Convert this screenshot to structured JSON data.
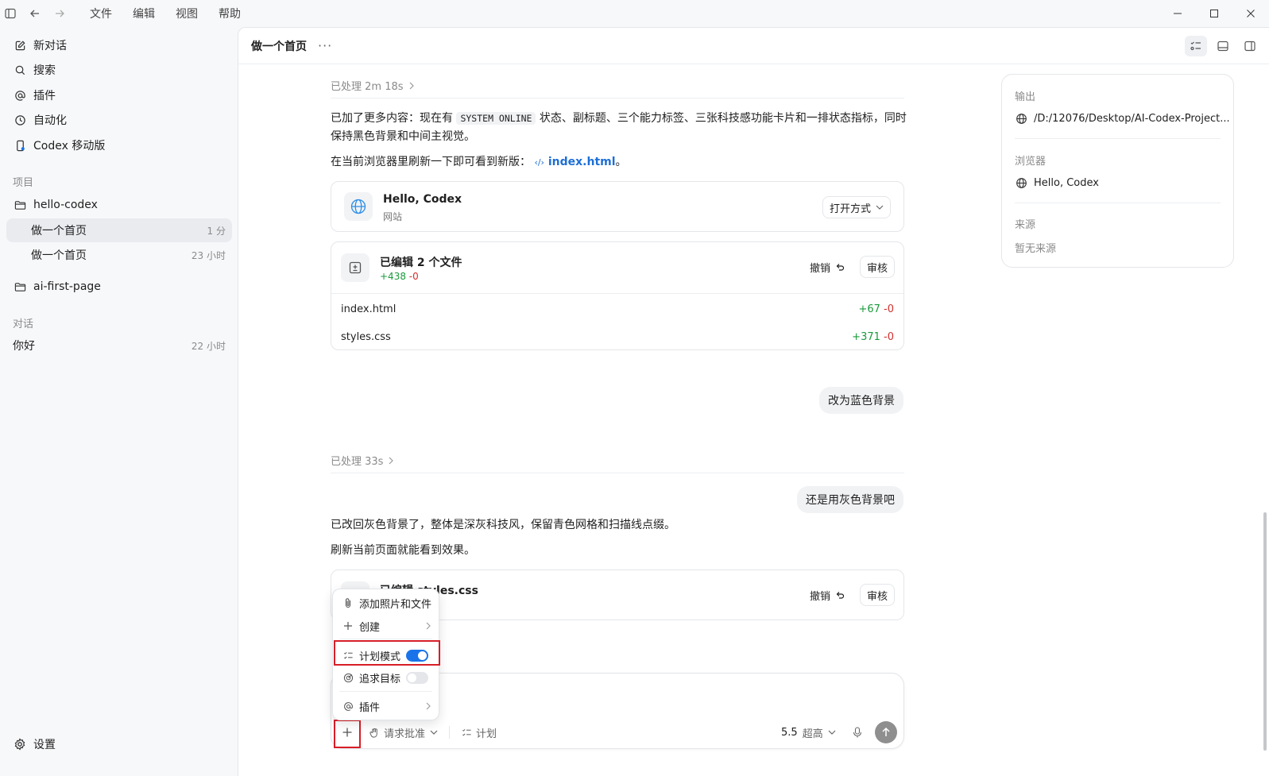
{
  "titlebar": {
    "menu": [
      "文件",
      "编辑",
      "视图",
      "帮助"
    ]
  },
  "sidebar": {
    "top_items": [
      {
        "label": "新对话",
        "icon": "edit-icon"
      },
      {
        "label": "搜索",
        "icon": "search-icon"
      },
      {
        "label": "插件",
        "icon": "at-icon"
      },
      {
        "label": "自动化",
        "icon": "clock-icon"
      },
      {
        "label": "Codex 移动版",
        "icon": "mobile-icon"
      }
    ],
    "projects_label": "项目",
    "projects": [
      {
        "name": "hello-codex",
        "icon": "folder-icon",
        "threads": [
          {
            "label": "做一个首页",
            "meta": "1 分",
            "active": true
          },
          {
            "label": "做一个首页",
            "meta": "23 小时",
            "active": false
          }
        ]
      },
      {
        "name": "ai-first-page",
        "icon": "folder-icon",
        "threads": []
      }
    ],
    "chats_label": "对话",
    "chats": [
      {
        "label": "你好",
        "meta": "22 小时"
      }
    ],
    "settings_label": "设置"
  },
  "main": {
    "title": "做一个首页",
    "more": "···",
    "processed_1": "已处理 2m 18s",
    "msg1_part1": "已加了更多内容：现在有",
    "msg1_code": "SYSTEM ONLINE",
    "msg1_part2": "状态、副标题、三个能力标签、三张科技感功能卡片和一排状态指标，同时",
    "msg1_line2": "保持黑色背景和中间主视觉。",
    "msg2_prefix": "在当前浏览器里刷新一下即可看到新版：",
    "msg2_link": "index.html",
    "msg2_suffix": "。",
    "site_card": {
      "title": "Hello, Codex",
      "subtitle": "网站",
      "open_with": "打开方式"
    },
    "edit_card": {
      "title": "已编辑 2 个文件",
      "added": "+438",
      "removed": "-0",
      "undo": "撤销",
      "review": "审核",
      "files": [
        {
          "name": "index.html",
          "added": "+67",
          "removed": "-0"
        },
        {
          "name": "styles.css",
          "added": "+371",
          "removed": "-0"
        }
      ]
    },
    "user_msg_1": "改为蓝色背景",
    "processed_2": "已处理 33s",
    "user_msg_2": "还是用灰色背景吧",
    "msg3": "已改回灰色背景了，整体是深灰科技风，保留青色网格和扫描线点缀。",
    "msg4": "刷新当前页面就能看到效果。",
    "edit_card_2": {
      "title": "已编辑 styles.css",
      "undo": "撤销",
      "review": "审核"
    }
  },
  "popup_menu": {
    "items": [
      {
        "label": "添加照片和文件",
        "icon": "paperclip-icon"
      },
      {
        "label": "创建",
        "icon": "plus-icon"
      },
      {
        "label": "计划模式",
        "icon": "checklist-icon",
        "toggle": true
      },
      {
        "label": "追求目标",
        "icon": "target-icon",
        "toggle": false
      },
      {
        "label": "插件",
        "icon": "at-icon"
      }
    ]
  },
  "composer": {
    "approval": "请求批准",
    "plan": "计划",
    "model": "5.5",
    "effort": "超高"
  },
  "right_panel": {
    "output_label": "输出",
    "output_value": "/D:/12076/Desktop/AI-Codex-Project...",
    "browser_label": "浏览器",
    "browser_value": "Hello, Codex",
    "source_label": "来源",
    "source_value": "暂无来源"
  },
  "colors": {
    "accent": "#1a73e8",
    "link": "#1d6fd6",
    "added": "#1a9a3b",
    "removed": "#d0312d",
    "highlight": "#d81e28"
  }
}
